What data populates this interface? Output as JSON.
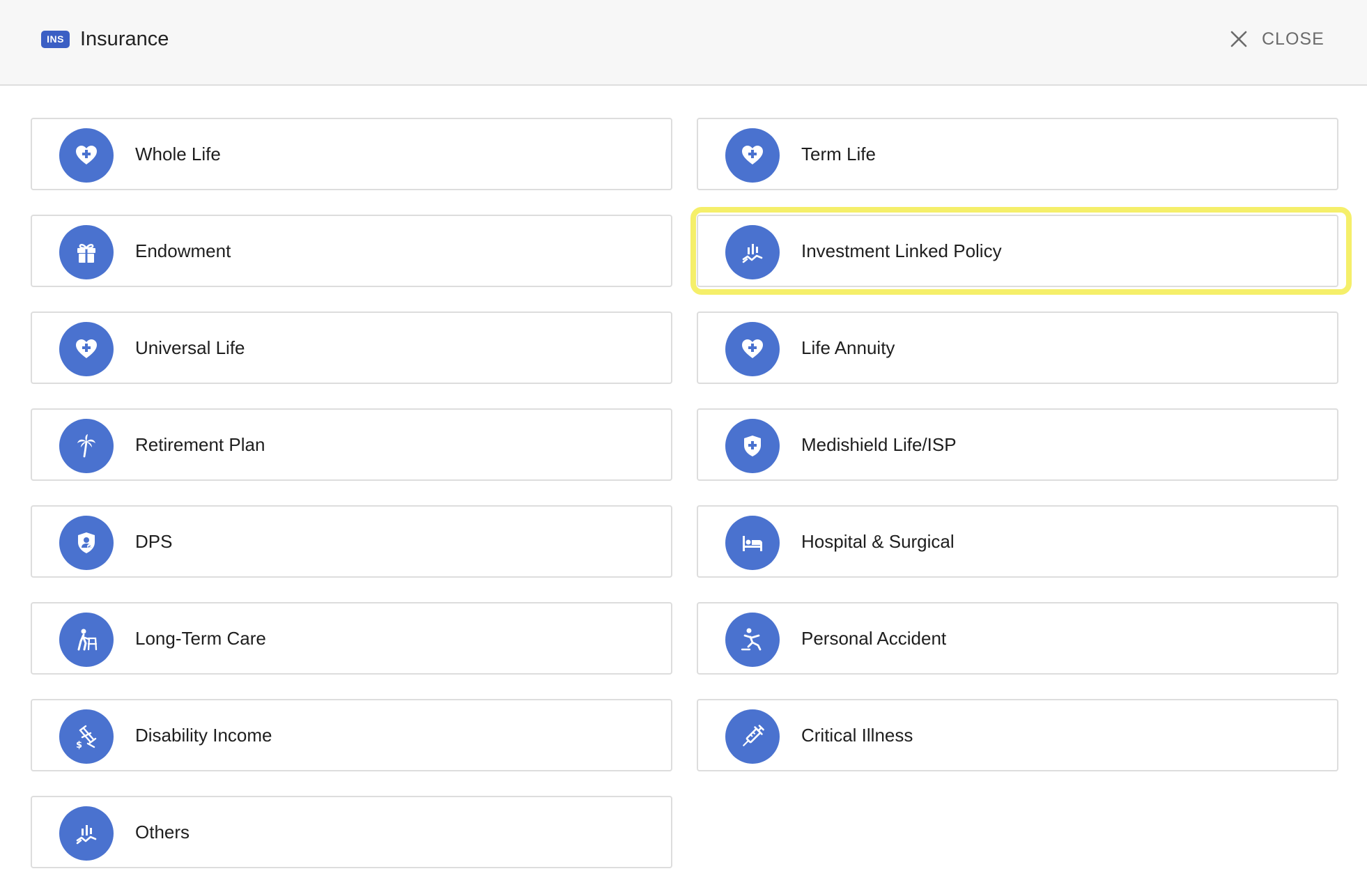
{
  "header": {
    "badge": "INS",
    "title": "Insurance",
    "close_label": "CLOSE"
  },
  "accent_color": "#4a72cf",
  "highlight_color": "#f5ef6a",
  "items": [
    {
      "label": "Whole Life",
      "icon": "heart-plus-icon"
    },
    {
      "label": "Term Life",
      "icon": "heart-plus-icon"
    },
    {
      "label": "Endowment",
      "icon": "gift-icon"
    },
    {
      "label": "Investment Linked Policy",
      "icon": "chart-trend-icon"
    },
    {
      "label": "Universal Life",
      "icon": "heart-plus-icon"
    },
    {
      "label": "Life Annuity",
      "icon": "heart-plus-icon"
    },
    {
      "label": "Retirement Plan",
      "icon": "palm-tree-icon"
    },
    {
      "label": "Medishield Life/ISP",
      "icon": "shield-plus-icon"
    },
    {
      "label": "DPS",
      "icon": "shield-person-icon"
    },
    {
      "label": "Hospital & Surgical",
      "icon": "hospital-bed-icon"
    },
    {
      "label": "Long-Term Care",
      "icon": "elderly-walker-icon"
    },
    {
      "label": "Personal Accident",
      "icon": "person-falling-icon"
    },
    {
      "label": "Disability Income",
      "icon": "crutch-dollar-icon"
    },
    {
      "label": "Critical Illness",
      "icon": "syringe-icon"
    },
    {
      "label": "Others",
      "icon": "chart-trend-icon"
    }
  ]
}
